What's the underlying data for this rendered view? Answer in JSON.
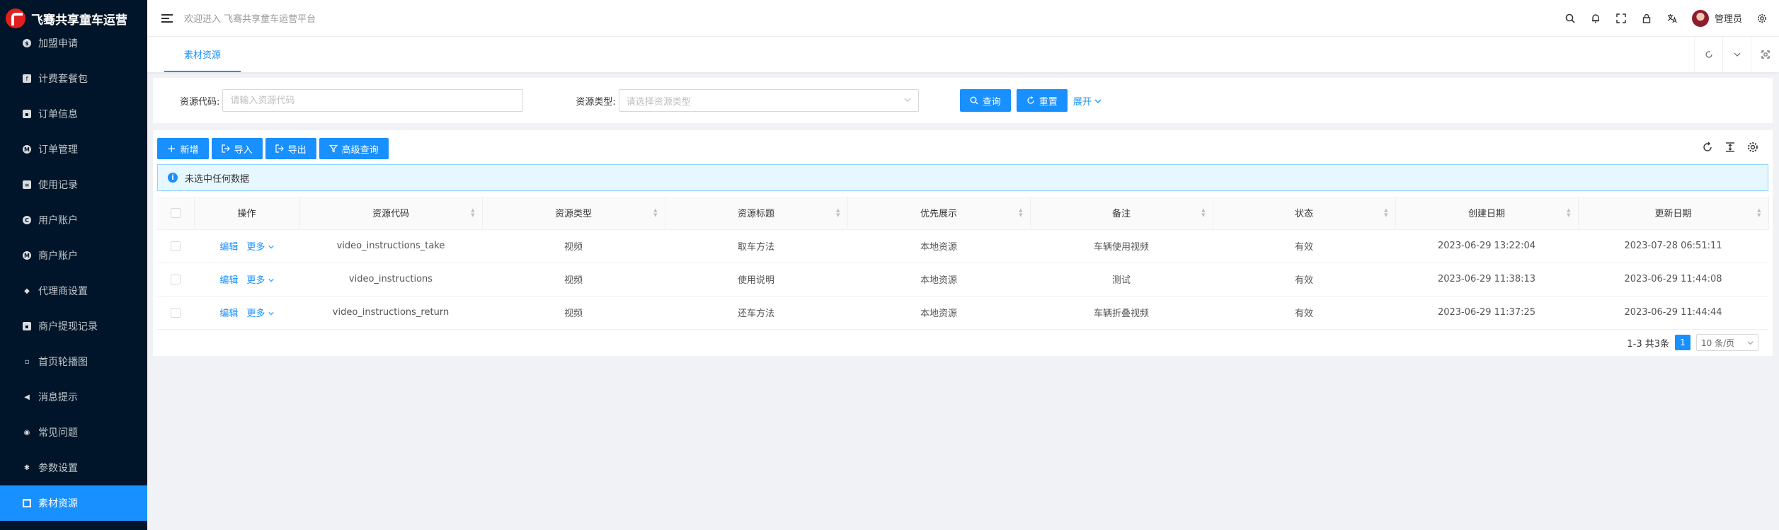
{
  "app": {
    "logo_text": "飞骞共享童车运营",
    "welcome": "欢迎进入 飞骞共享童车运营平台",
    "user_name": "管理员"
  },
  "sidebar": {
    "items": [
      {
        "label": "加盟申请",
        "icon": "dollar-circle-icon",
        "glyph": "$",
        "shape": "circle"
      },
      {
        "label": "计费套餐包",
        "icon": "facebook-square-icon",
        "glyph": "f",
        "shape": "square"
      },
      {
        "label": "订单信息",
        "icon": "order-square-icon",
        "glyph": "▪",
        "shape": "square"
      },
      {
        "label": "订单管理",
        "icon": "m-circle-icon",
        "glyph": "M",
        "shape": "circle"
      },
      {
        "label": "使用记录",
        "icon": "file-text-icon",
        "glyph": "≡",
        "shape": "square"
      },
      {
        "label": "用户账户",
        "icon": "copyright-circle-icon",
        "glyph": "C",
        "shape": "circle"
      },
      {
        "label": "商户账户",
        "icon": "m-circle-icon",
        "glyph": "M",
        "shape": "circle"
      },
      {
        "label": "代理商设置",
        "icon": "android-icon",
        "glyph": "◆",
        "shape": "plain"
      },
      {
        "label": "商户提现记录",
        "icon": "account-book-icon",
        "glyph": "▪",
        "shape": "square"
      },
      {
        "label": "首页轮播图",
        "icon": "picture-icon",
        "glyph": "▫",
        "shape": "plain"
      },
      {
        "label": "消息提示",
        "icon": "sound-icon",
        "glyph": "◀",
        "shape": "plain"
      },
      {
        "label": "常见问题",
        "icon": "eye-icon",
        "glyph": "◉",
        "shape": "plain"
      },
      {
        "label": "参数设置",
        "icon": "setting-icon",
        "glyph": "✱",
        "shape": "plain"
      },
      {
        "label": "素材资源",
        "icon": "video-camera-icon",
        "glyph": "■",
        "shape": "plain",
        "active": true
      }
    ]
  },
  "tabs": [
    {
      "label": "素材资源",
      "active": true
    }
  ],
  "search": {
    "code_label": "资源代码:",
    "code_placeholder": "请输入资源代码",
    "type_label": "资源类型:",
    "type_placeholder": "请选择资源类型",
    "query_button": "查询",
    "reset_button": "重置",
    "expand_link": "展开"
  },
  "toolbar": {
    "add": "新增",
    "import": "导入",
    "export": "导出",
    "advanced": "高级查询"
  },
  "alert": {
    "text": "未选中任何数据"
  },
  "table": {
    "columns": [
      "操作",
      "资源代码",
      "资源类型",
      "资源标题",
      "优先展示",
      "备注",
      "状态",
      "创建日期",
      "更新日期"
    ],
    "edit_label": "编辑",
    "more_label": "更多",
    "rows": [
      {
        "code": "video_instructions_take",
        "type": "视频",
        "title": "取车方法",
        "priority": "本地资源",
        "remark": "车辆使用视频",
        "status": "有效",
        "created": "2023-06-29 13:22:04",
        "updated": "2023-07-28 06:51:11"
      },
      {
        "code": "video_instructions",
        "type": "视频",
        "title": "使用说明",
        "priority": "本地资源",
        "remark": "测试",
        "status": "有效",
        "created": "2023-06-29 11:38:13",
        "updated": "2023-06-29 11:44:08"
      },
      {
        "code": "video_instructions_return",
        "type": "视频",
        "title": "还车方法",
        "priority": "本地资源",
        "remark": "车辆折叠视频",
        "status": "有效",
        "created": "2023-06-29 11:37:25",
        "updated": "2023-06-29 11:44:44"
      }
    ]
  },
  "pagination": {
    "summary": "1-3 共3条",
    "current": "1",
    "page_size": "10 条/页"
  },
  "colors": {
    "primary": "#1890ff",
    "sidebar_bg": "#001529",
    "alert_bg": "#e6f7ff"
  }
}
